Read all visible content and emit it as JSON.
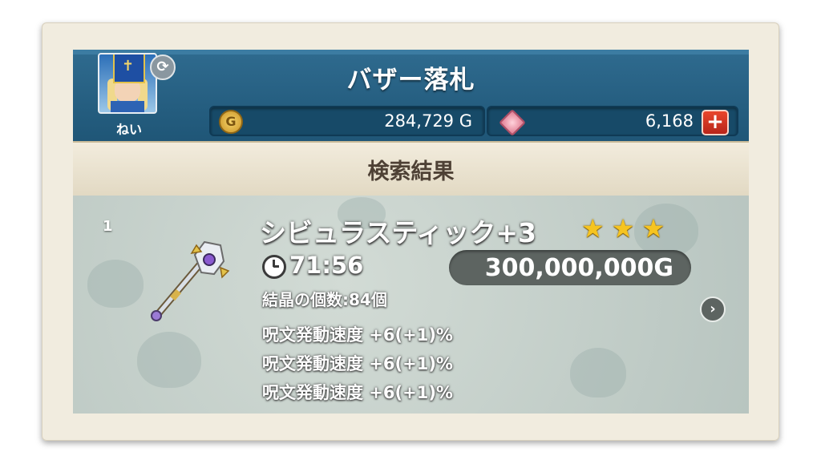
{
  "header": {
    "title": "バザー落札",
    "player_name": "ねい",
    "gold": "284,729 G",
    "gems": "6,168",
    "add_gem_symbol": "+",
    "swap_symbol": "⟳",
    "coin_symbol": "G"
  },
  "subheader": {
    "label": "検索結果"
  },
  "result": {
    "rank": "1",
    "item_name": "シビュラスティック+3",
    "stars": 3,
    "star_glyph": "★",
    "time_left": "71:56",
    "price": "300,000,000G",
    "crystal_count": "結晶の個数:84個",
    "stats": [
      "呪文発動速度  +6(+1)%",
      "呪文発動速度  +6(+1)%",
      "呪文発動速度  +6(+1)%"
    ],
    "next_symbol": "›"
  },
  "icons": {
    "avatar": "avatar-icon",
    "swap": "swap-character-icon",
    "coin": "gold-coin-icon",
    "gem": "gem-icon",
    "add": "plus-icon",
    "clock": "clock-icon",
    "staff": "staff-item-icon",
    "star": "star-icon",
    "next": "chevron-right-icon"
  },
  "colors": {
    "header_blue": "#1f5677",
    "bar_blue": "#174a68",
    "star_gold": "#f6c420",
    "plus_red": "#c8301f",
    "price_pill": "#5d6461"
  }
}
